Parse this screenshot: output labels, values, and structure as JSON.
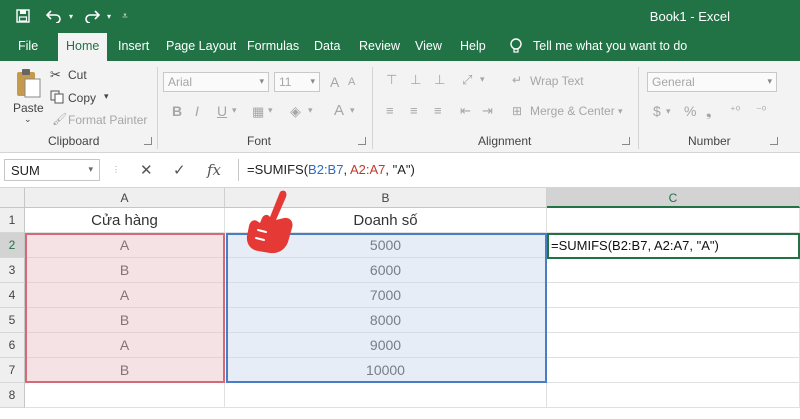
{
  "titlebar": {
    "doc_title": "Book1  -  Excel",
    "quick_access": [
      "save-icon",
      "undo-icon",
      "redo-icon",
      "customize-icon"
    ]
  },
  "tabs": [
    "File",
    "Home",
    "Insert",
    "Page Layout",
    "Formulas",
    "Data",
    "Review",
    "View",
    "Help"
  ],
  "active_tab": "Home",
  "tell_me": "Tell me what you want to do",
  "ribbon": {
    "clipboard": {
      "paste": "Paste",
      "cut": "Cut",
      "copy": "Copy",
      "format_painter": "Format Painter",
      "label": "Clipboard"
    },
    "font": {
      "font_name": "Arial",
      "font_size": "11",
      "bold": "B",
      "italic": "I",
      "underline": "U",
      "grow": "A",
      "shrink": "A",
      "color_letter": "A",
      "label": "Font"
    },
    "alignment": {
      "wrap_text": "Wrap Text",
      "merge_center": "Merge & Center",
      "label": "Alignment"
    },
    "number": {
      "format": "General",
      "currency": "$",
      "percent": "%",
      "label": "Number"
    }
  },
  "formula_bar": {
    "name_box": "SUM",
    "fx": "fx",
    "formula_prefix": "=SUMIFS(",
    "formula_ref1": "B2:B7",
    "formula_sep1": ", ",
    "formula_ref2": "A2:A7",
    "formula_suffix": ", \"A\")"
  },
  "grid": {
    "columns": [
      "A",
      "B",
      "C"
    ],
    "rows": [
      "1",
      "2",
      "3",
      "4",
      "5",
      "6",
      "7",
      "8"
    ],
    "header_a": "Cửa hàng",
    "header_b": "Doanh số",
    "store": [
      "A",
      "B",
      "A",
      "B",
      "A",
      "B"
    ],
    "sales": [
      "5000",
      "6000",
      "7000",
      "8000",
      "9000",
      "10000"
    ],
    "active_cell_text": "=SUMIFS(B2:B7, A2:A7, \"A\")",
    "colors": {
      "excel_green": "#217346",
      "range_a_border": "#d46a77",
      "range_b_border": "#4a7ec4",
      "hand_red": "#e53935"
    }
  }
}
